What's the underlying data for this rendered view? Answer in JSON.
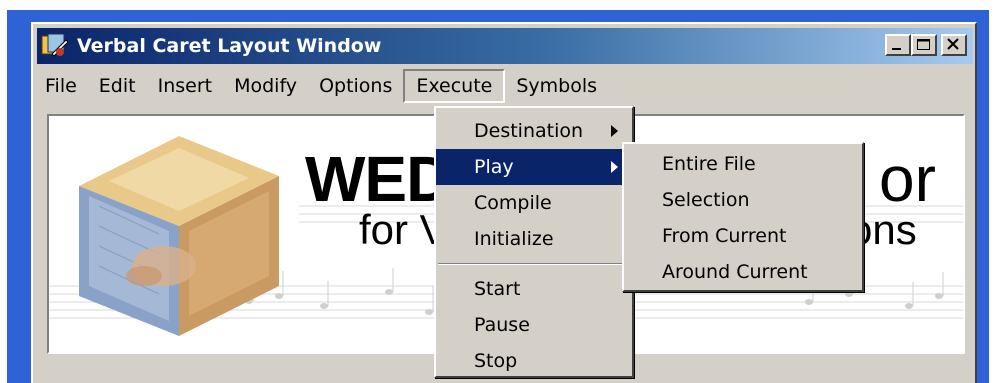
{
  "window": {
    "title": "Verbal Caret Layout Window",
    "icon": "app-icon",
    "caption_buttons": [
      "minimize-icon",
      "maximize-icon",
      "close-icon"
    ]
  },
  "menubar": {
    "items": [
      "File",
      "Edit",
      "Insert",
      "Modify",
      "Options",
      "Execute",
      "Symbols"
    ],
    "active": "Execute"
  },
  "banner": {
    "title_left": "WED",
    "title_right": "or",
    "subtitle_left": "for V",
    "subtitle_right": "ons"
  },
  "execute_menu": {
    "items": [
      "Destination",
      "Play",
      "Compile",
      "Initialize",
      "Start",
      "Pause",
      "Stop"
    ],
    "highlighted": "Play"
  },
  "play_submenu": {
    "items": [
      "Entire File",
      "Selection",
      "From Current",
      "Around Current"
    ]
  },
  "colors": {
    "title_bar_start": "#0a246a",
    "title_bar_end": "#a6caf0",
    "window_border": "#2f62d6",
    "menu_face": "#d4d0c8",
    "highlight": "#0a246a"
  }
}
